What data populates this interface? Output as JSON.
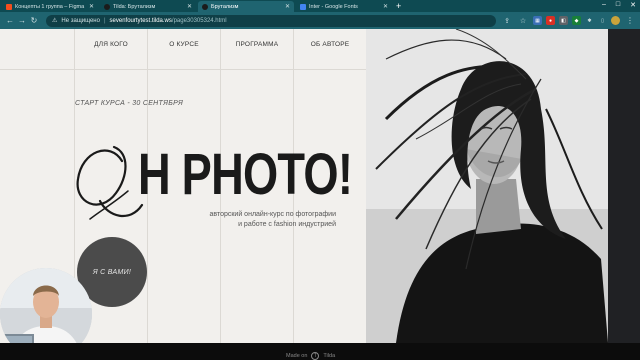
{
  "browser": {
    "tabs": [
      {
        "title": "Концепты 1 группа – Figma",
        "favicon_color": "#f24e1e",
        "active": false
      },
      {
        "title": "Tilda: Брутализм",
        "favicon_color": "#1b1b1b",
        "active": false
      },
      {
        "title": "Брутализм",
        "favicon_color": "#1b1b1b",
        "active": true
      },
      {
        "title": "Inter - Google Fonts",
        "favicon_color": "#4285f4",
        "active": false
      }
    ],
    "new_tab_icon": "+",
    "window_controls": [
      "–",
      "□",
      "✕"
    ],
    "omnibox": {
      "security_label": "Не защищено",
      "url_domain": "sevenfourtytest.tilda.ws",
      "url_path": "/page30305324.html"
    }
  },
  "site": {
    "nav": [
      "ДЛЯ КОГО",
      "О КУРСЕ",
      "ПРОГРАММА",
      "ОБ АВТОРЕ"
    ],
    "start_text": "СТАРТ КУРСА - 30 СЕНТЯБРЯ",
    "headline": "Н PHOTO!",
    "subtitle_line1": "авторский онлайн-курс по фотографии",
    "subtitle_line2": "и работе с fashion индустрией",
    "cta_label": "Я С ВАМИ!",
    "footer_made_on": "Made on",
    "footer_brand": "Tilda"
  },
  "colors": {
    "tab_bar": "#0e4a52",
    "toolbar": "#1f6470",
    "page_bg": "#f2f0ed",
    "headline": "#1a1a1a",
    "cta_bg": "#4b4b4b"
  }
}
